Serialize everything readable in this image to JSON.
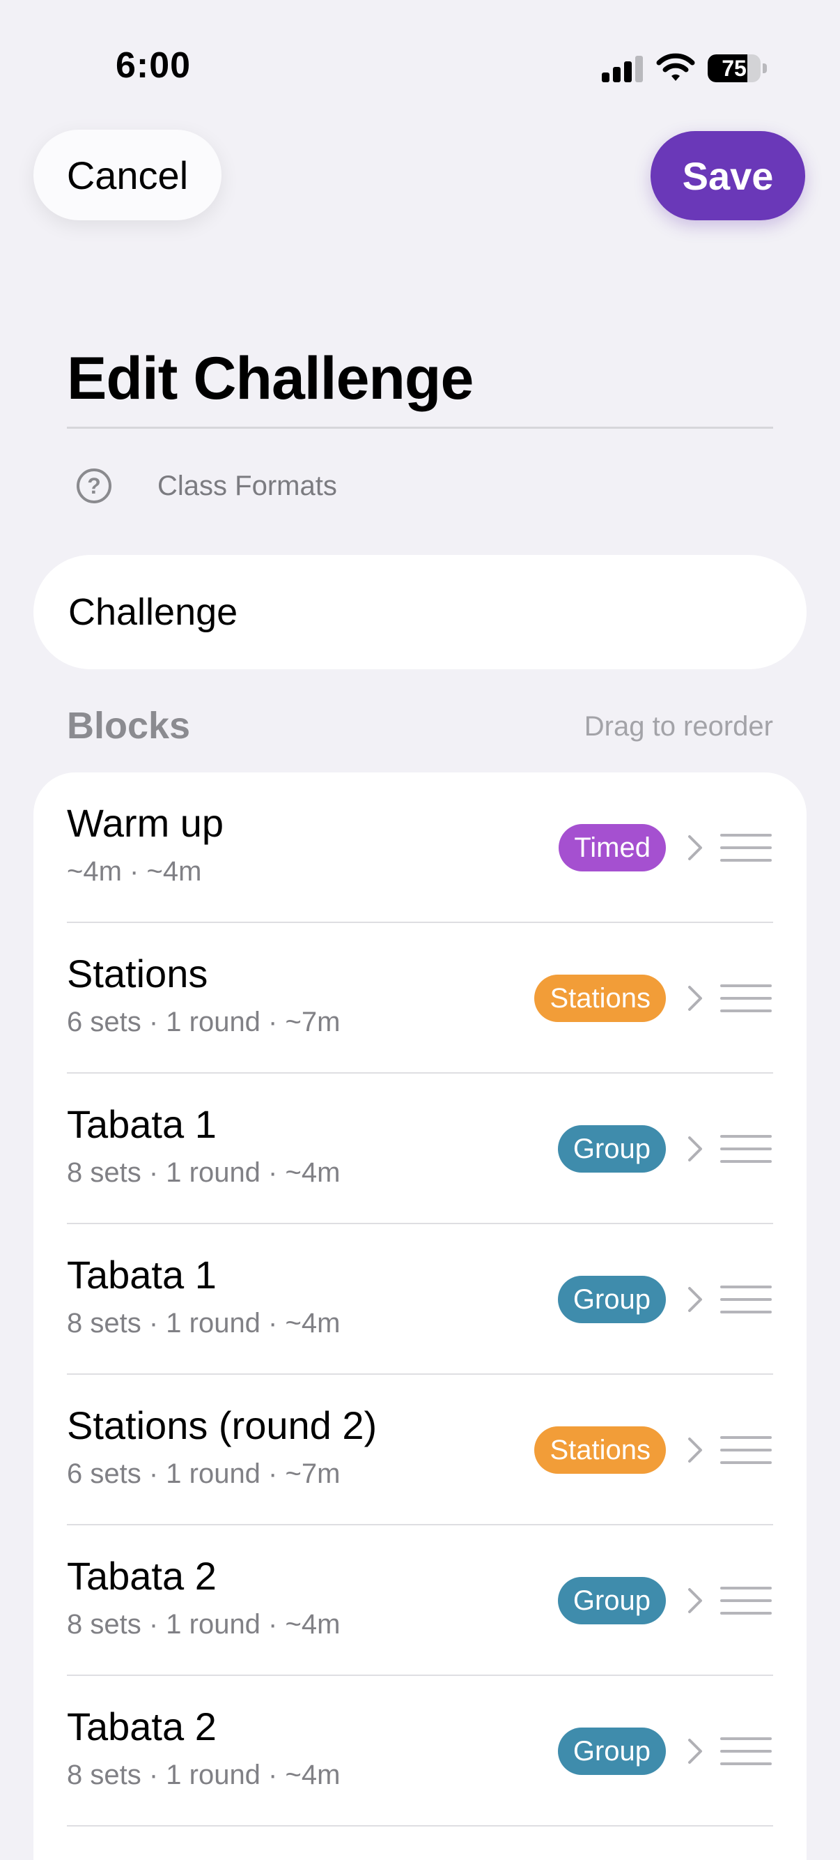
{
  "status_bar": {
    "time": "6:00",
    "battery": "75",
    "battery_level": 0.75
  },
  "header": {
    "cancel_label": "Cancel",
    "save_label": "Save",
    "title": "Edit Challenge"
  },
  "help": {
    "icon": "question-circle-icon",
    "label": "Class Formats"
  },
  "name_field": {
    "value": "Challenge"
  },
  "blocks_section": {
    "heading": "Blocks",
    "hint": "Drag to reorder"
  },
  "blocks": [
    {
      "name": "Warm up",
      "meta": "~4m · ~4m",
      "badge": "Timed",
      "badge_color": "#a550d0"
    },
    {
      "name": "Stations",
      "meta": "6 sets · 1 round · ~7m",
      "badge": "Stations",
      "badge_color": "#f29d38"
    },
    {
      "name": "Tabata 1",
      "meta": "8 sets · 1 round · ~4m",
      "badge": "Group",
      "badge_color": "#3f8cac"
    },
    {
      "name": "Tabata 1",
      "meta": "8 sets · 1 round · ~4m",
      "badge": "Group",
      "badge_color": "#3f8cac"
    },
    {
      "name": "Stations (round 2)",
      "meta": "6 sets · 1 round · ~7m",
      "badge": "Stations",
      "badge_color": "#f29d38"
    },
    {
      "name": "Tabata 2",
      "meta": "8 sets · 1 round · ~4m",
      "badge": "Group",
      "badge_color": "#3f8cac"
    },
    {
      "name": "Tabata 2",
      "meta": "8 sets · 1 round · ~4m",
      "badge": "Group",
      "badge_color": "#3f8cac"
    }
  ],
  "colors": {
    "accent": "#6a38b8",
    "background": "#f2f1f6"
  }
}
